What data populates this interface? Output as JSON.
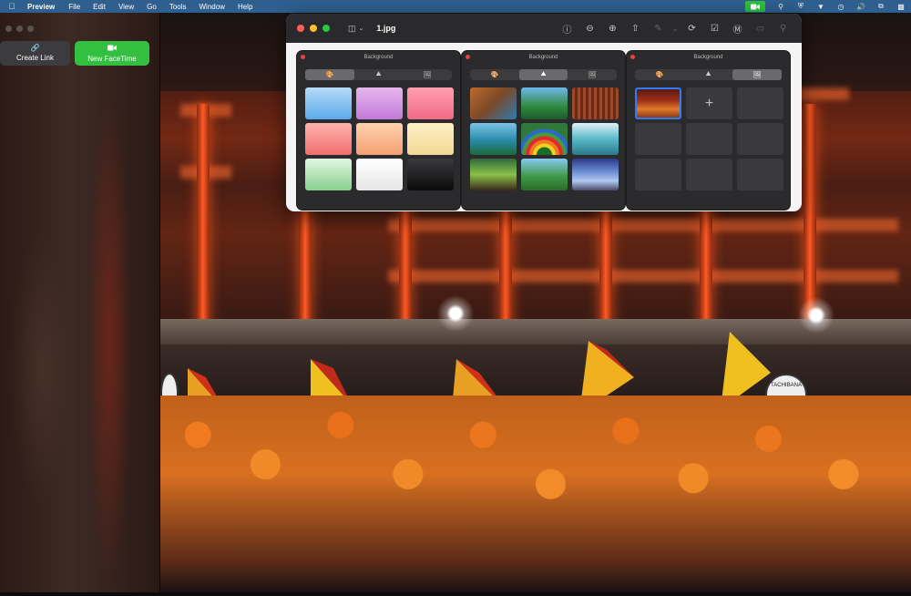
{
  "menubar": {
    "app_name": "Preview",
    "items": [
      "File",
      "Edit",
      "View",
      "Go",
      "Tools",
      "Window",
      "Help"
    ],
    "status_icons": [
      "facetime-camera-icon",
      "location-icon",
      "shield-icon",
      "vpn-icon",
      "clock-icon",
      "volume-icon",
      "screen-mirroring-icon",
      "control-center-icon"
    ]
  },
  "facetime": {
    "create_link_label": "Create Link",
    "new_facetime_label": "New FaceTime",
    "accent_color": "#33c040"
  },
  "preview": {
    "file_title": "1.jpg",
    "toolbar": [
      "info-icon",
      "zoom-out-icon",
      "zoom-in-icon",
      "share-icon",
      "markup-icon",
      "rotate-icon",
      "highlight-icon",
      "annotate-icon",
      "crop-icon",
      "search-icon"
    ],
    "panels": [
      {
        "title": "Background",
        "active_tab": 0,
        "tabs": [
          "palette-icon",
          "landscape-icon",
          "photo-icon"
        ],
        "cells": [
          {
            "type": "color",
            "fill": "linear-gradient(180deg,#b7dcf6,#5aa9ec)"
          },
          {
            "type": "color",
            "fill": "linear-gradient(180deg,#e6b6ee,#c27ad8)"
          },
          {
            "type": "color",
            "fill": "linear-gradient(180deg,#ff9fb0,#f06a86)"
          },
          {
            "type": "color",
            "fill": "linear-gradient(180deg,#ffb1ae,#f07070)"
          },
          {
            "type": "color",
            "fill": "linear-gradient(180deg,#ffd2ae,#f3a071)"
          },
          {
            "type": "color",
            "fill": "linear-gradient(180deg,#fff0c4,#f2d894)"
          },
          {
            "type": "color",
            "fill": "linear-gradient(180deg,#e2f6e2,#87d08e)"
          },
          {
            "type": "color",
            "fill": "linear-gradient(180deg,#ffffff,#e6e6e6)"
          },
          {
            "type": "color",
            "fill": "linear-gradient(180deg,#3a3a3c,#0b0b0c)"
          }
        ]
      },
      {
        "title": "Background",
        "active_tab": 1,
        "tabs": [
          "palette-icon",
          "landscape-icon",
          "photo-icon"
        ],
        "cells": [
          {
            "type": "image",
            "fill": "linear-gradient(135deg,#c06a2a,#7a4a2a 50%,#2e7ab0)"
          },
          {
            "type": "image",
            "fill": "linear-gradient(180deg,#6fb7e8 0%,#2f8a3f 60%,#1d5a2a)"
          },
          {
            "type": "image",
            "fill": "repeating-linear-gradient(90deg,#9a4a2a 0 3px,#6a2a18 3px 6px)"
          },
          {
            "type": "image",
            "fill": "linear-gradient(180deg,#7ac2e6 0%,#2a8aa8 55%,#1d6a3a)"
          },
          {
            "type": "image",
            "fill": "radial-gradient(circle at 50% 100%,#1a6a2a 0 8px,#f0d020 9px 12px,#f07a20 13px 16px,#e02a2a 17px 20px,#4a9a3a 21px 24px,#2a6ad0 25px 28px,#2f7a3a 29px)"
          },
          {
            "type": "image",
            "fill": "linear-gradient(180deg,#dff0f8 0%,#5ab8c8 50%,#2a7a8a)"
          },
          {
            "type": "image",
            "fill": "linear-gradient(180deg,#2e6a3a,#8ac04a 50%,#3a2a1a)"
          },
          {
            "type": "image",
            "fill": "linear-gradient(180deg,#8ac8f0 0%,#3f9a4a 55%,#2a6a2a)"
          },
          {
            "type": "image",
            "fill": "linear-gradient(180deg,#2a3a8a,#6a8ad0 40%,#b0c8f0 70%,#4a4a6a)"
          }
        ]
      },
      {
        "title": "Background",
        "active_tab": 2,
        "tabs": [
          "palette-icon",
          "landscape-icon",
          "photo-icon"
        ],
        "cells": [
          {
            "type": "selected-photo",
            "fill": "linear-gradient(180deg,#5a1a12 0%,#a0301a 40%,#e07a2a 70%,#8a3a1a)"
          },
          {
            "type": "add",
            "label": "+"
          },
          {
            "type": "empty"
          },
          {
            "type": "empty"
          },
          {
            "type": "empty"
          },
          {
            "type": "empty"
          },
          {
            "type": "empty"
          },
          {
            "type": "empty"
          },
          {
            "type": "empty"
          }
        ]
      }
    ]
  },
  "photo": {
    "banner_text": "TACHIBANA"
  }
}
